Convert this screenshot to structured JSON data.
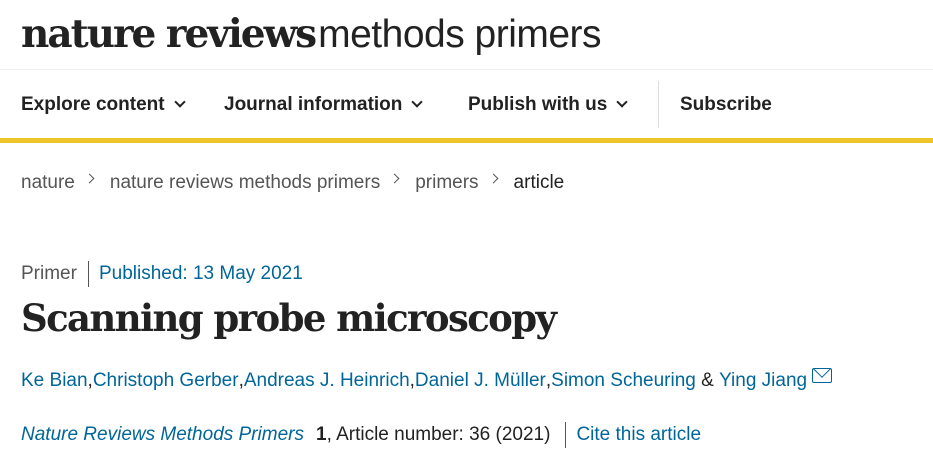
{
  "header": {
    "logo_bold": "nature reviews",
    "logo_light": "methods primers"
  },
  "nav": {
    "items": [
      {
        "label": "Explore content",
        "has_dropdown": true
      },
      {
        "label": "Journal information",
        "has_dropdown": true
      },
      {
        "label": "Publish with us",
        "has_dropdown": true
      }
    ],
    "subscribe_label": "Subscribe"
  },
  "colors": {
    "accent": "#eec52a",
    "link": "#006699",
    "text": "#222222",
    "muted": "#555555"
  },
  "breadcrumb": {
    "items": [
      "nature",
      "nature reviews methods primers",
      "primers"
    ],
    "current": "article"
  },
  "article": {
    "type": "Primer",
    "published": "Published: 13 May 2021",
    "title": "Scanning probe microscopy",
    "authors": [
      "Ke Bian",
      "Christoph Gerber",
      "Andreas J. Heinrich",
      "Daniel J. Müller",
      "Simon Scheuring",
      "Ying Jiang"
    ],
    "author_separators": [
      ", ",
      ", ",
      ", ",
      ", ",
      " & "
    ],
    "citation": {
      "journal": "Nature Reviews Methods Primers",
      "volume": "1",
      "article_number_text": ", Article number: 36 (2021)",
      "cite_label": "Cite this article"
    }
  }
}
